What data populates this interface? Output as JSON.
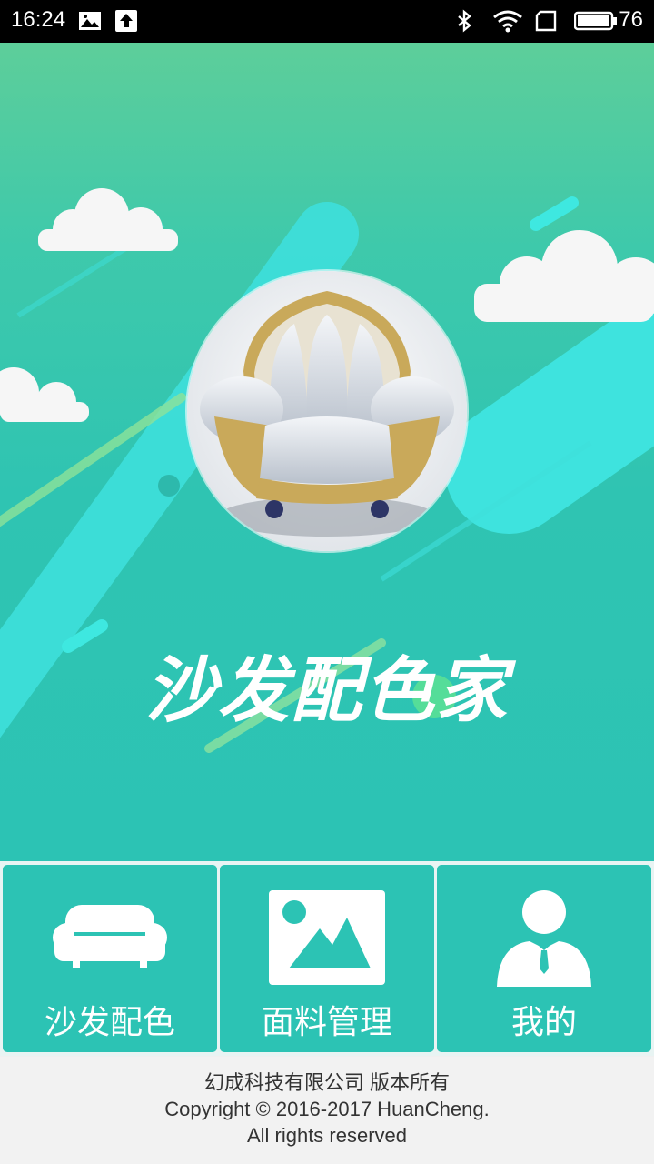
{
  "status_bar": {
    "time": "16:24",
    "battery_level": "76",
    "icons": [
      "image-icon",
      "upload-icon",
      "bluetooth-icon",
      "wifi-icon",
      "sim-icon",
      "battery-icon"
    ]
  },
  "hero": {
    "app_title": "沙发配色家",
    "logo_image": "armchair-photo"
  },
  "menu": {
    "items": [
      {
        "label": "沙发配色",
        "icon": "sofa-icon"
      },
      {
        "label": "面料管理",
        "icon": "picture-icon"
      },
      {
        "label": "我的",
        "icon": "person-icon"
      }
    ]
  },
  "footer": {
    "line1": "幻成科技有限公司 版本所有",
    "line2": "Copyright © 2016-2017 HuanCheng.",
    "line3": "All rights reserved"
  },
  "colors": {
    "accent": "#2cc3b4",
    "hero_top": "#5dce9a",
    "status_bar": "#000000",
    "footer_bg": "#f2f2f2"
  }
}
